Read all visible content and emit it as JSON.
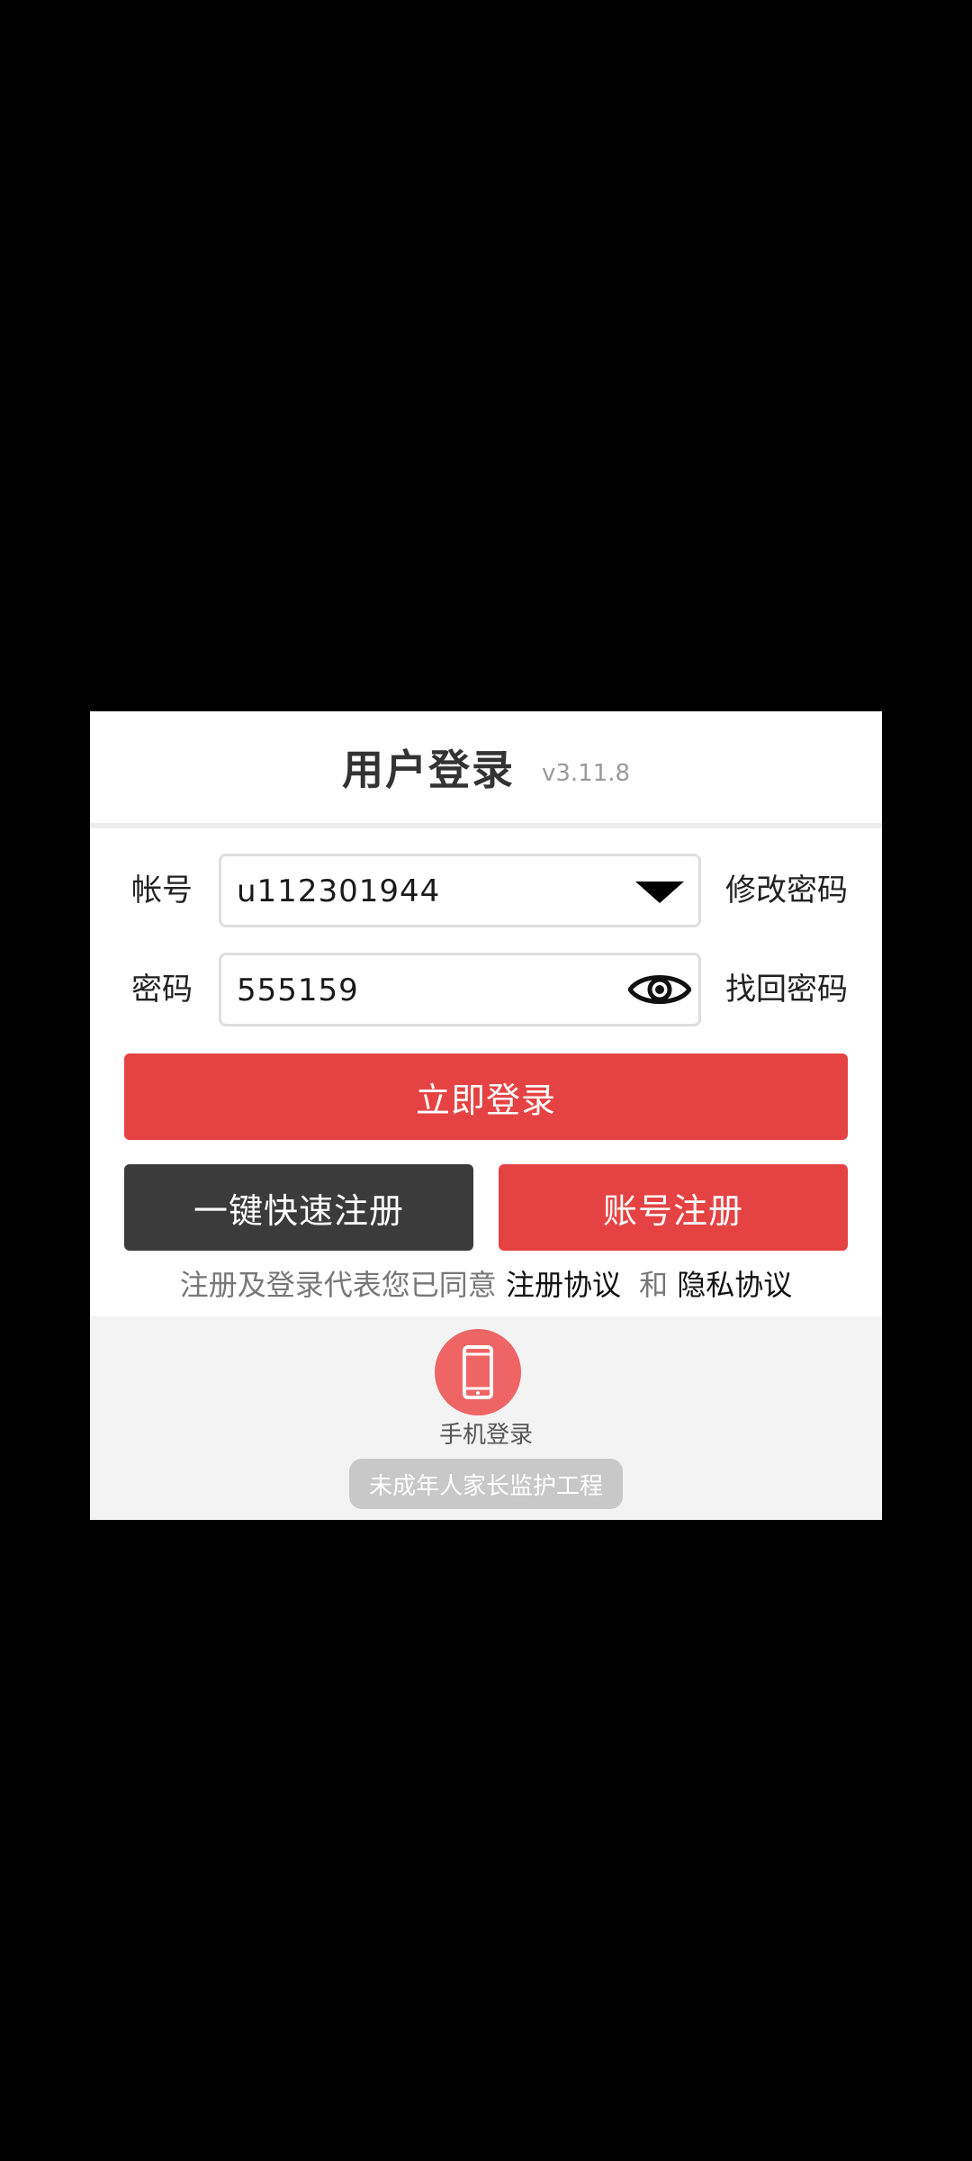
{
  "dialog": {
    "title": "用户登录",
    "version": "v3.11.8"
  },
  "account": {
    "label": "帐号",
    "value": "u112301944",
    "link": "修改密码",
    "icon": "dropdown-triangle-icon"
  },
  "password": {
    "label": "密码",
    "value": "555159",
    "link": "找回密码",
    "icon": "eye-icon"
  },
  "buttons": {
    "login": "立即登录",
    "quick_register": "一键快速注册",
    "account_register": "账号注册"
  },
  "agreement": {
    "prefix": "注册及登录代表您已同意",
    "terms": "注册协议",
    "and": "和",
    "privacy": "隐私协议"
  },
  "footer": {
    "phone_login_label": "手机登录",
    "phone_icon": "smartphone-icon",
    "guardian_label": "未成年人家长监护工程"
  },
  "colors": {
    "primary_red": "#e54343",
    "dark_button": "#3b3b3b",
    "phone_circle": "#ef6464",
    "footer_bg": "#f3f3f3"
  }
}
